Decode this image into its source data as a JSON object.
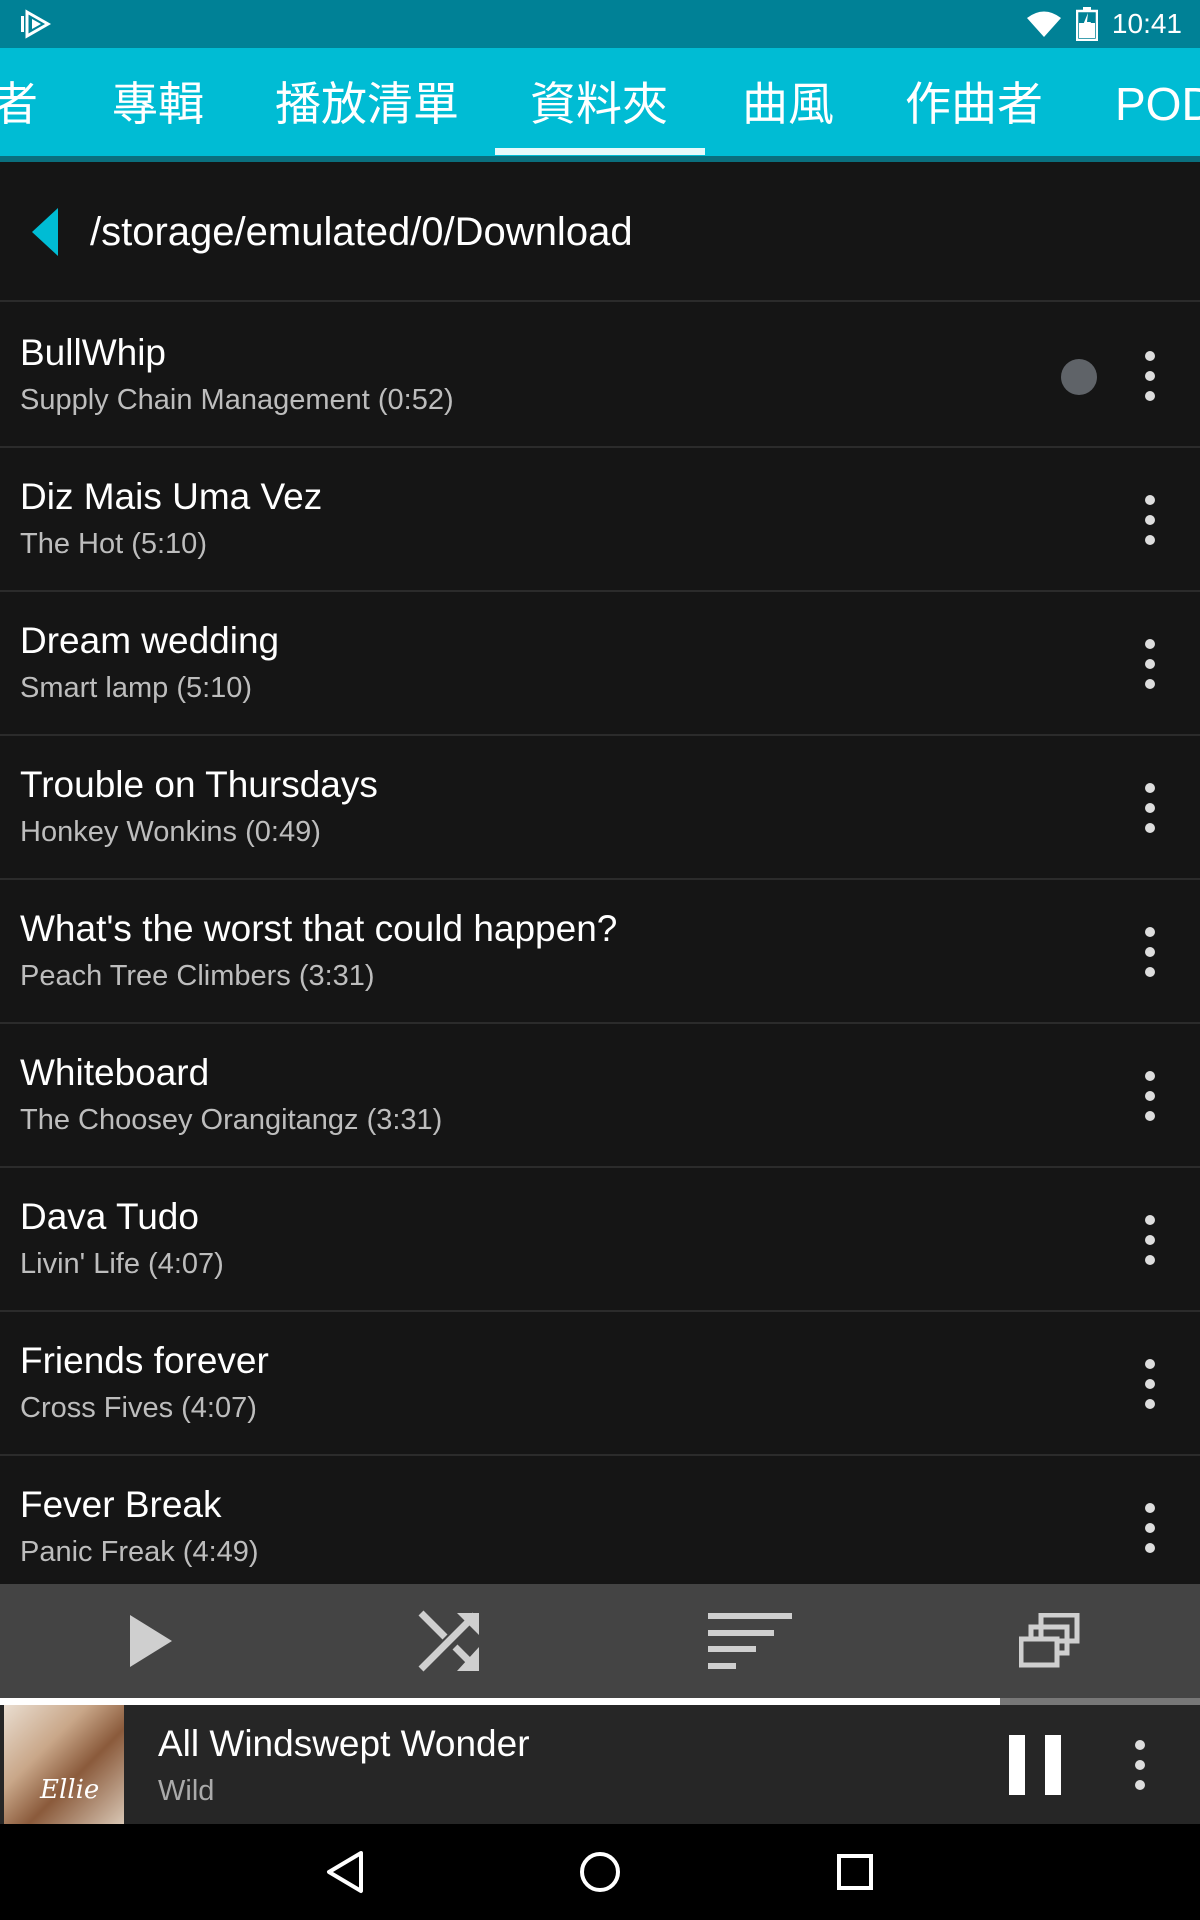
{
  "status_bar": {
    "time": "10:41",
    "icons": [
      "app-play-icon",
      "wifi-icon",
      "battery-icon"
    ]
  },
  "tabs": [
    {
      "label": "者"
    },
    {
      "label": "專輯"
    },
    {
      "label": "播放清單"
    },
    {
      "label": "資料夾",
      "selected": true
    },
    {
      "label": "曲風"
    },
    {
      "label": "作曲者"
    },
    {
      "label": "POD"
    }
  ],
  "path": {
    "text": "/storage/emulated/0/Download"
  },
  "tracks": [
    {
      "title": "BullWhip",
      "subtitle": "Supply Chain Management (0:52)",
      "playing": true
    },
    {
      "title": "Diz Mais Uma Vez",
      "subtitle": "The Hot (5:10)"
    },
    {
      "title": "Dream wedding",
      "subtitle": "Smart lamp (5:10)"
    },
    {
      "title": "Trouble on Thursdays",
      "subtitle": "Honkey Wonkins (0:49)"
    },
    {
      "title": "What's the worst that could happen?",
      "subtitle": "Peach Tree Climbers (3:31)"
    },
    {
      "title": "Whiteboard",
      "subtitle": "The Choosey Orangitangz (3:31)"
    },
    {
      "title": "Dava Tudo",
      "subtitle": "Livin' Life (4:07)"
    },
    {
      "title": "Friends forever",
      "subtitle": "Cross Fives (4:07)"
    },
    {
      "title": "Fever Break",
      "subtitle": "Panic Freak (4:49)"
    }
  ],
  "controls": [
    "play-icon",
    "shuffle-icon",
    "sort-icon",
    "queue-icon"
  ],
  "now_playing": {
    "title": "All Windswept Wonder",
    "artist": "Wild",
    "album_art_text": "Ellie",
    "progress": 0.833
  },
  "colors": {
    "status_bar": "#008196",
    "accent": "#00bcd4",
    "background": "#151515",
    "control_bar": "#444444",
    "now_playing_bar": "#262626"
  }
}
